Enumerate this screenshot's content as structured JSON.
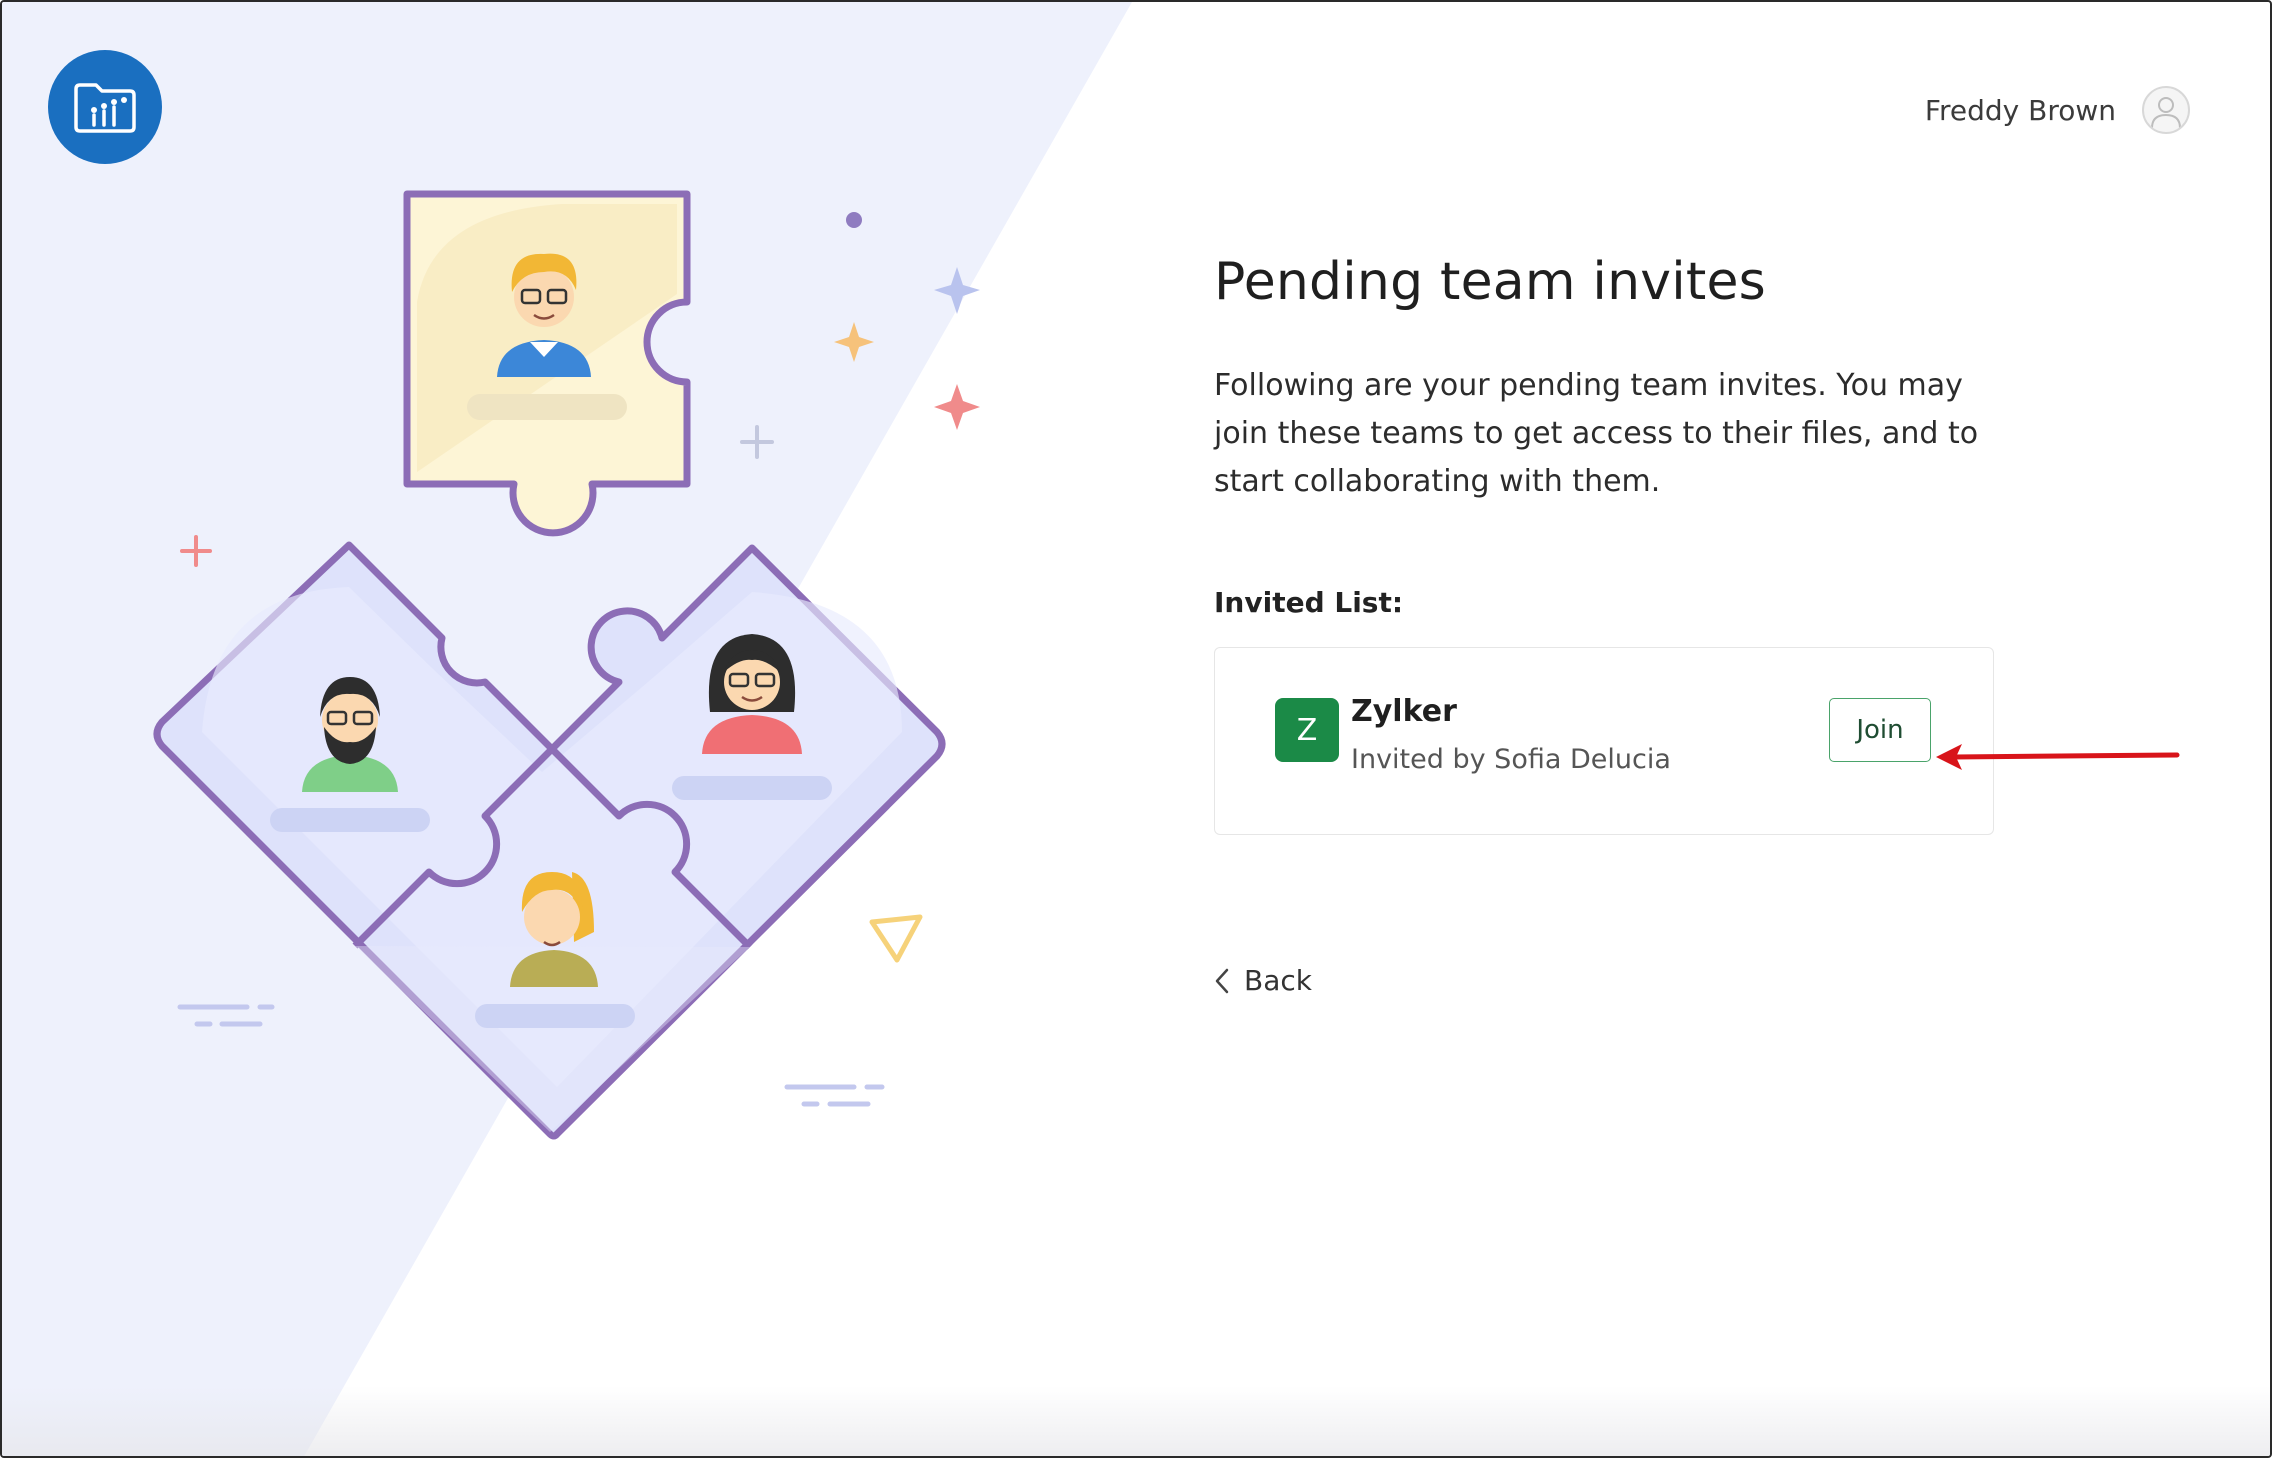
{
  "header": {
    "user_name": "Freddy Brown"
  },
  "main": {
    "title": "Pending team invites",
    "description": "Following are your pending team invites. You may join these teams to get access to their files, and to start collaborating with them.",
    "list_label": "Invited List:",
    "invites": [
      {
        "avatar_letter": "Z",
        "team_name": "Zylker",
        "invited_by": "Invited by Sofia Delucia",
        "join_label": "Join"
      }
    ],
    "back_label": "Back"
  },
  "icons": {
    "logo": "folder-chart-icon",
    "avatar": "user-avatar-icon",
    "back": "chevron-left-icon"
  },
  "colors": {
    "brand_blue": "#1a6fc0",
    "team_green": "#1b8a47",
    "join_border": "#4aa36a",
    "illustration_bg": "#eef1fc",
    "annotation_red": "#d8141a"
  }
}
